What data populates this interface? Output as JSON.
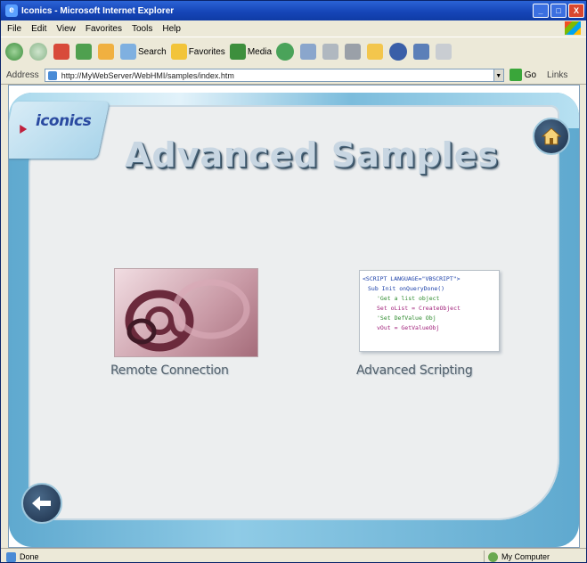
{
  "window": {
    "title": "Iconics - Microsoft Internet Explorer",
    "controls": [
      "_",
      "□",
      "X"
    ]
  },
  "menu": [
    "File",
    "Edit",
    "View",
    "Favorites",
    "Tools",
    "Help"
  ],
  "toolbar": {
    "back": "Back",
    "search": "Search",
    "favorites": "Favorites",
    "media": "Media"
  },
  "addressbar": {
    "label": "Address",
    "url": "http://MyWebServer/WebHMI/samples/index.htm",
    "go": "Go",
    "links": "Links"
  },
  "page": {
    "logo": "iconics",
    "title": "Advanced Samples",
    "tiles": [
      {
        "label": "Remote Connection",
        "icon": "at-sign-icon"
      },
      {
        "label": "Advanced Scripting",
        "icon": "script-code-icon"
      }
    ],
    "code_lines": [
      "<SCRIPT LANGUAGE=\"VBSCRIPT\">",
      "Sub Init onQueryDone()",
      "  'Get a list object",
      "  Set oList = CreateObject",
      "  'Set DefValue Obj",
      "  vOut = GetValueObj"
    ],
    "colors": {
      "frame": "#5fa9cf",
      "panel": "#eceeef",
      "title": "#c8d6e2"
    }
  },
  "status": {
    "text": "Done",
    "zone": "My Computer"
  }
}
